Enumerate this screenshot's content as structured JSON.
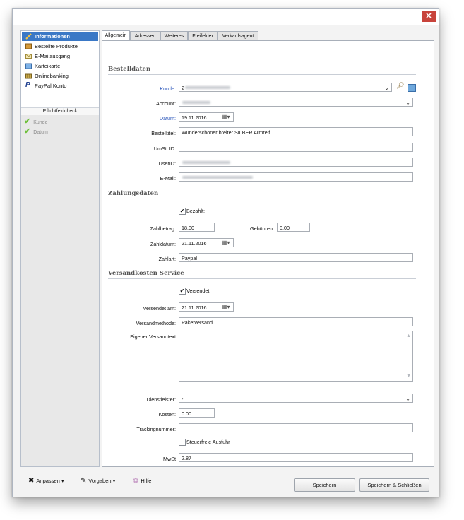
{
  "window": {
    "close_label": "✕"
  },
  "sidebar": {
    "items": [
      {
        "label": "Informationen",
        "icon": "pencil-icon",
        "active": true
      },
      {
        "label": "Bestellte Produkte",
        "icon": "box-icon"
      },
      {
        "label": "E-Mailausgang",
        "icon": "mail-icon"
      },
      {
        "label": "Karteikarte",
        "icon": "card-icon"
      },
      {
        "label": "Onlinebanking",
        "icon": "bank-icon"
      },
      {
        "label": "PayPal Konto",
        "icon": "paypal-icon"
      }
    ],
    "check_header": "Pflichtfeldcheck",
    "checks": [
      {
        "label": "Kunde"
      },
      {
        "label": "Datum"
      }
    ]
  },
  "tabs": [
    {
      "label": "Allgemein"
    },
    {
      "label": "Adressen"
    },
    {
      "label": "Weiteres"
    },
    {
      "label": "Freifelder"
    },
    {
      "label": "Verkaufsagent"
    }
  ],
  "sections": {
    "bestelldaten": "Bestelldaten",
    "zahlungsdaten": "Zahlungsdaten",
    "versandkosten": "Versandkosten Service"
  },
  "bestelldaten": {
    "kunde_label": "Kunde:",
    "kunde_value": "2",
    "account_label": "Account:",
    "datum_label": "Datum:",
    "datum_value": "19.11.2016",
    "titel_label": "Bestelltitel:",
    "titel_value": "Wunderschöner breiter SILBER Armreif",
    "ust_label": "UmSt. ID:",
    "userid_label": "UserID:",
    "email_label": "E-Mail:"
  },
  "zahlungsdaten": {
    "bezahlt_label": "Bezahlt:",
    "zahlbetrag_label": "Zahlbetrag:",
    "zahlbetrag_value": "18.00",
    "gebuehren_label": "Gebühren:",
    "gebuehren_value": "0.00",
    "zahldatum_label": "Zahldatum:",
    "zahldatum_value": "21.11.2016",
    "zahlart_label": "Zahlart:",
    "zahlart_value": "Paypal"
  },
  "versand": {
    "versendet_label": "Versendet:",
    "versendet_am_label": "Versendet am:",
    "versendet_am_value": "21.11.2016",
    "methode_label": "Versandmethode:",
    "methode_value": "Paketversand",
    "eigener_label": "Eigener Versandtext",
    "dienstleister_label": "Dienstleister:",
    "dienstleister_value": "-",
    "kosten_label": "Kosten:",
    "kosten_value": "0.00",
    "tracking_label": "Trackingnummer:",
    "steuerfrei_label": "Steuerfreie Ausfuhr",
    "mwst_label": "MwSt",
    "mwst_value": "2.87"
  },
  "bottom": {
    "anpassen": "Anpassen",
    "vorgaben": "Vorgaben",
    "hilfe": "Hilfe",
    "speichern": "Speichern",
    "speichern_schliessen": "Speichern & Schließen"
  }
}
